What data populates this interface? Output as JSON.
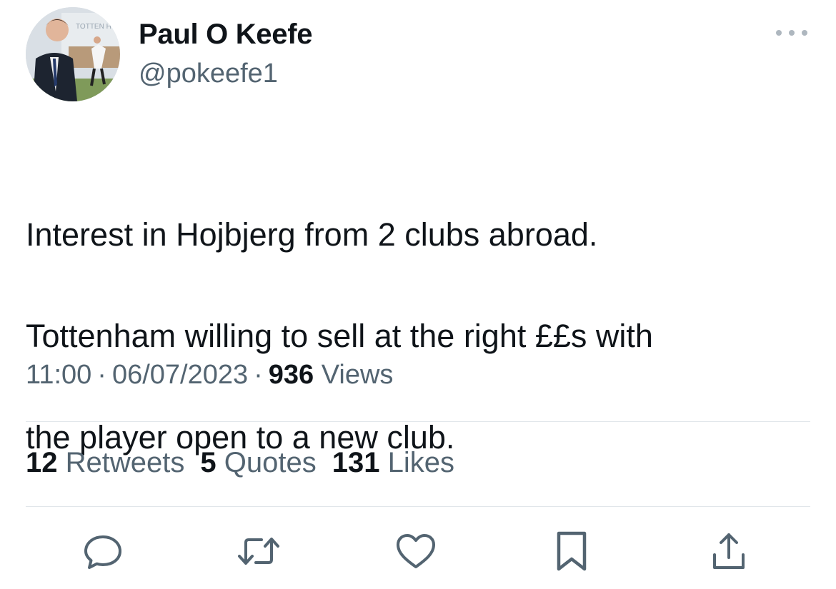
{
  "author": {
    "name": "Paul O Keefe",
    "handle": "@pokeefe1",
    "avatar_text": "TOTTEN HOT"
  },
  "tweet": {
    "text_lines": [
      "Interest in Hojbjerg from 2 clubs abroad.",
      "Tottenham willing to sell at the right ££s with",
      "the player open to a new club."
    ],
    "time": "11:00",
    "date": "06/07/2023",
    "separator": "·",
    "views_count": "936",
    "views_label": "Views"
  },
  "stats": {
    "retweets_count": "12",
    "retweets_label": "Retweets",
    "quotes_count": "5",
    "quotes_label": "Quotes",
    "likes_count": "131",
    "likes_label": "Likes"
  },
  "actions": [
    "reply-icon",
    "retweet-icon",
    "like-icon",
    "bookmark-icon",
    "share-icon"
  ],
  "colors": {
    "text_primary": "#0f1419",
    "text_secondary": "#536471",
    "divider": "#e1e6ea",
    "icon": "#536471"
  }
}
